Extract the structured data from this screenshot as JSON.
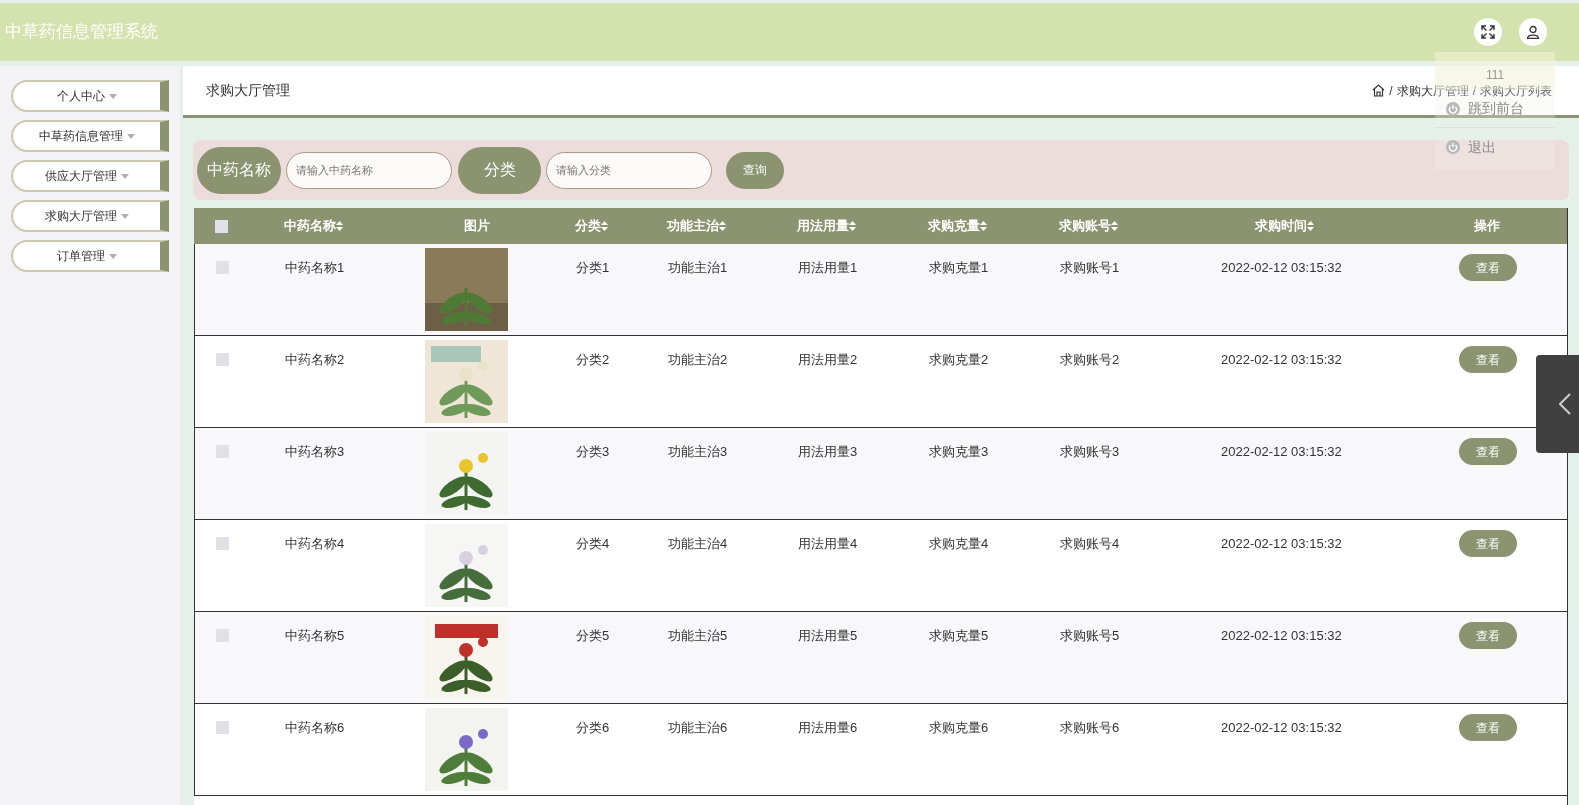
{
  "header": {
    "title": "中草药信息管理系统"
  },
  "user_menu": {
    "name": "111",
    "items": [
      "跳到前台",
      "退出"
    ]
  },
  "sidebar": {
    "items": [
      {
        "label": "个人中心",
        "expanded": false
      },
      {
        "label": "中草药信息管理",
        "expanded": false
      },
      {
        "label": "供应大厅管理",
        "expanded": false
      },
      {
        "label": "求购大厅管理",
        "expanded": false
      },
      {
        "label": "订单管理",
        "expanded": false
      }
    ]
  },
  "page_title": "求购大厅管理",
  "breadcrumb": [
    "求购大厅管理",
    "求购大厅列表"
  ],
  "breadcrumb_separator": "/",
  "search": {
    "fields": [
      {
        "label": "中药名称",
        "placeholder": "请输入中药名称"
      },
      {
        "label": "分类",
        "placeholder": "请输入分类"
      }
    ],
    "button": "查询"
  },
  "table": {
    "select_all": false,
    "columns": [
      {
        "label": "中药名称",
        "sortable": true
      },
      {
        "label": "图片",
        "sortable": false
      },
      {
        "label": "分类",
        "sortable": true
      },
      {
        "label": "功能主治",
        "sortable": true
      },
      {
        "label": "用法用量",
        "sortable": true
      },
      {
        "label": "求购克量",
        "sortable": true
      },
      {
        "label": "求购账号",
        "sortable": true
      },
      {
        "label": "求购时间",
        "sortable": true
      },
      {
        "label": "操作",
        "sortable": false
      }
    ],
    "rows": [
      {
        "checked": false,
        "name": "中药名称1",
        "category": "分类1",
        "function": "功能主治1",
        "usage": "用法用量1",
        "quantity": "求购克量1",
        "account": "求购账号1",
        "time": "2022-02-12 03:15:32",
        "action": "查看"
      },
      {
        "checked": false,
        "name": "中药名称2",
        "category": "分类2",
        "function": "功能主治2",
        "usage": "用法用量2",
        "quantity": "求购克量2",
        "account": "求购账号2",
        "time": "2022-02-12 03:15:32",
        "action": "查看"
      },
      {
        "checked": false,
        "name": "中药名称3",
        "category": "分类3",
        "function": "功能主治3",
        "usage": "用法用量3",
        "quantity": "求购克量3",
        "account": "求购账号3",
        "time": "2022-02-12 03:15:32",
        "action": "查看"
      },
      {
        "checked": false,
        "name": "中药名称4",
        "category": "分类4",
        "function": "功能主治4",
        "usage": "用法用量4",
        "quantity": "求购克量4",
        "account": "求购账号4",
        "time": "2022-02-12 03:15:32",
        "action": "查看"
      },
      {
        "checked": false,
        "name": "中药名称5",
        "category": "分类5",
        "function": "功能主治5",
        "usage": "用法用量5",
        "quantity": "求购克量5",
        "account": "求购账号5",
        "time": "2022-02-12 03:15:32",
        "action": "查看"
      },
      {
        "checked": false,
        "name": "中药名称6",
        "category": "分类6",
        "function": "功能主治6",
        "usage": "用法用量6",
        "quantity": "求购克量6",
        "account": "求购账号6",
        "time": "2022-02-12 03:15:32",
        "action": "查看"
      }
    ]
  }
}
